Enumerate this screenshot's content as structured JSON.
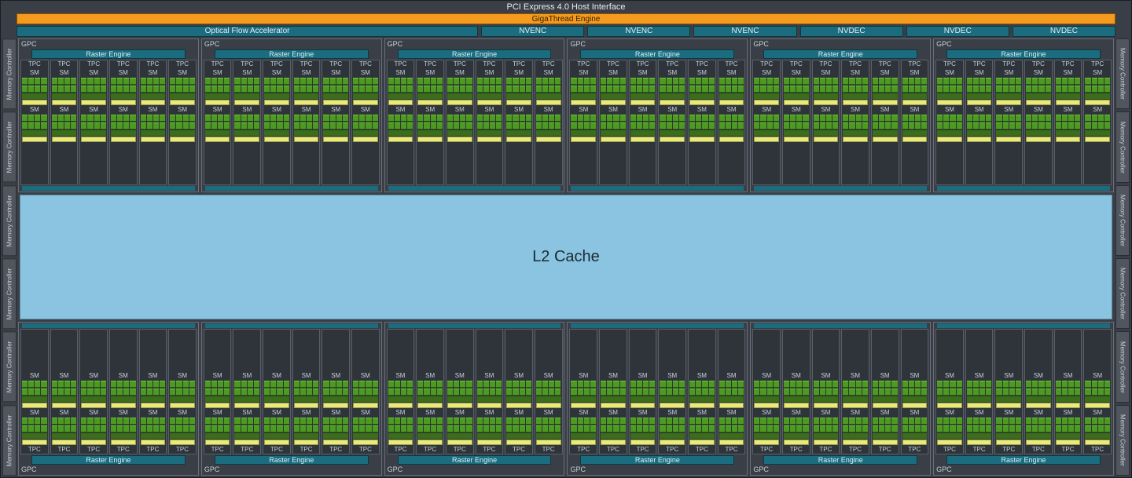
{
  "pcie": "PCI Express 4.0 Host Interface",
  "gigathread": "GigaThread Engine",
  "ofa": "Optical Flow Accelerator",
  "encdec": [
    "NVENC",
    "NVENC",
    "NVENC",
    "NVDEC",
    "NVDEC",
    "NVDEC"
  ],
  "mem_label": "Memory Controller",
  "mem_left_count": 6,
  "mem_right_count": 6,
  "gpc_label": "GPC",
  "raster": "Raster Engine",
  "tpc_label": "TPC",
  "sm_label": "SM",
  "l2": "L2 Cache",
  "gpc_per_row": 6,
  "tpc_per_gpc": 6,
  "sm_per_tpc": 2,
  "colors": {
    "accent_teal": "#1a6c7e",
    "accent_orange": "#f39a1f",
    "cuda_green": "#4c9a1f",
    "tensor_green": "#3a6e1a",
    "rt_yellow": "#e8ea7a",
    "l2_blue": "#8ac4e0",
    "frame_grey": "#3a3f47"
  }
}
